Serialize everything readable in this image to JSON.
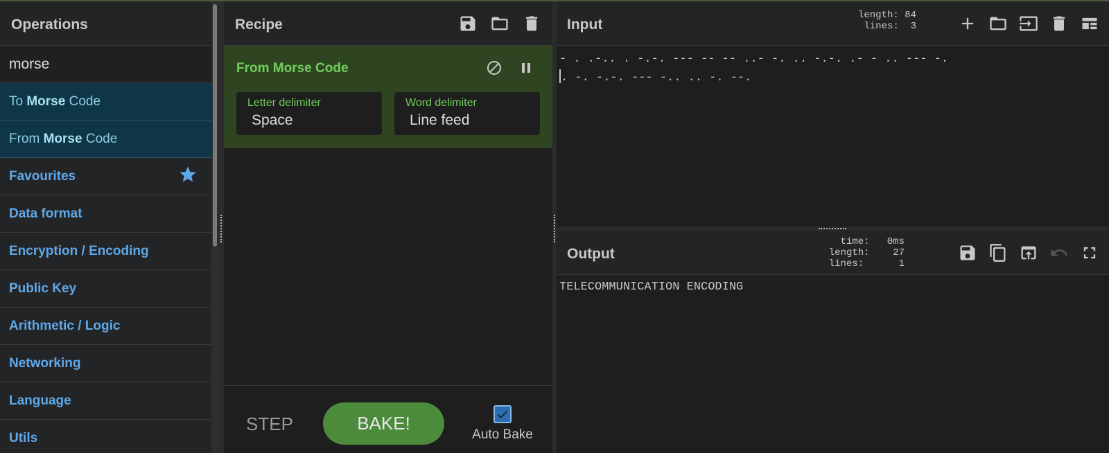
{
  "operations": {
    "title": "Operations",
    "search_value": "morse",
    "results": [
      {
        "prefix": "To ",
        "match": "Morse",
        "suffix": " Code"
      },
      {
        "prefix": "From ",
        "match": "Morse",
        "suffix": " Code"
      }
    ],
    "categories": [
      {
        "label": "Favourites",
        "icon": "star-icon"
      },
      {
        "label": "Data format"
      },
      {
        "label": "Encryption / Encoding"
      },
      {
        "label": "Public Key"
      },
      {
        "label": "Arithmetic / Logic"
      },
      {
        "label": "Networking"
      },
      {
        "label": "Language"
      },
      {
        "label": "Utils"
      }
    ]
  },
  "recipe": {
    "title": "Recipe",
    "tools": [
      "save-icon",
      "folder-icon",
      "trash-icon"
    ],
    "operation": {
      "name": "From Morse Code",
      "args": [
        {
          "label": "Letter delimiter",
          "value": "Space"
        },
        {
          "label": "Word delimiter",
          "value": "Line feed"
        }
      ]
    },
    "step_label": "STEP",
    "bake_label": "BAKE!",
    "autobake_label": "Auto Bake",
    "autobake_checked": true
  },
  "input": {
    "title": "Input",
    "length_label": "length:",
    "length_value": "84",
    "lines_label": "lines:",
    "lines_value": "3",
    "lines": [
      "- . .-.. . -.-. --- -- -- ..- -. .. -.-. .- - .. --- -.",
      ". -. -.-. --- -.. .. -. --."
    ]
  },
  "output": {
    "title": "Output",
    "time_label": "time:",
    "time_value": "0ms",
    "length_label": "length:",
    "length_value": "27",
    "lines_label": "lines:",
    "lines_value": "1",
    "text": "TELECOMMUNICATION ENCODING"
  },
  "colors": {
    "accent_green": "#6fcf5a",
    "bake_green": "#4c8a3c",
    "link_blue": "#5fa8e8",
    "result_bg": "#0f3646"
  }
}
